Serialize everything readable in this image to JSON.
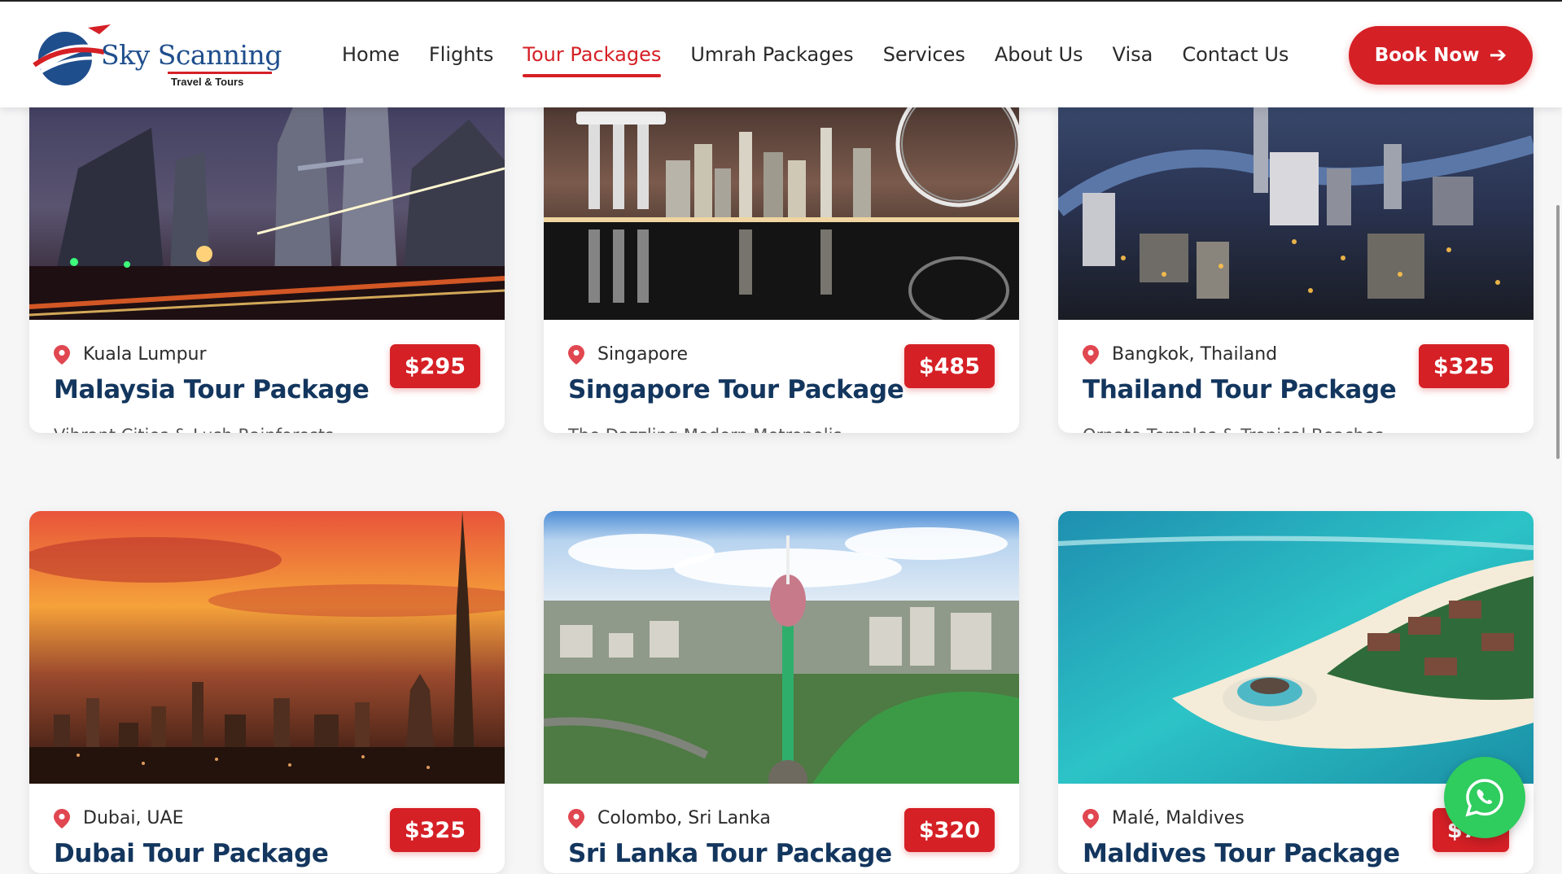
{
  "brand": {
    "name": "Sky Scanning",
    "tagline": "Travel & Tours"
  },
  "nav": {
    "items": [
      "Home",
      "Flights",
      "Tour Packages",
      "Umrah Packages",
      "Services",
      "About Us",
      "Visa",
      "Contact Us"
    ],
    "active": "Tour Packages"
  },
  "header": {
    "book_label": "Book Now"
  },
  "packages": [
    {
      "location": "Kuala Lumpur",
      "title": "Malaysia Tour Package",
      "description": "Vibrant Cities & Lush Rainforests",
      "price": "$295"
    },
    {
      "location": "Singapore",
      "title": "Singapore Tour Package",
      "description": "The Dazzling Modern Metropolis",
      "price": "$485"
    },
    {
      "location": "Bangkok, Thailand",
      "title": "Thailand Tour Package",
      "description": "Ornate Temples & Tropical Beaches",
      "price": "$325"
    },
    {
      "location": "Dubai, UAE",
      "title": "Dubai Tour Package",
      "description": "",
      "price": "$325"
    },
    {
      "location": "Colombo, Sri Lanka",
      "title": "Sri Lanka Tour Package",
      "description": "",
      "price": "$320"
    },
    {
      "location": "Malé, Maldives",
      "title": "Maldives Tour Package",
      "description": "",
      "price": "$7··"
    }
  ],
  "icons": {
    "location": "map-pin-icon",
    "book_arrow": "arrow-right-icon",
    "chat": "whatsapp-icon"
  },
  "colors": {
    "accent": "#d52026",
    "title": "#13365e",
    "whatsapp": "#2fcc5e"
  }
}
